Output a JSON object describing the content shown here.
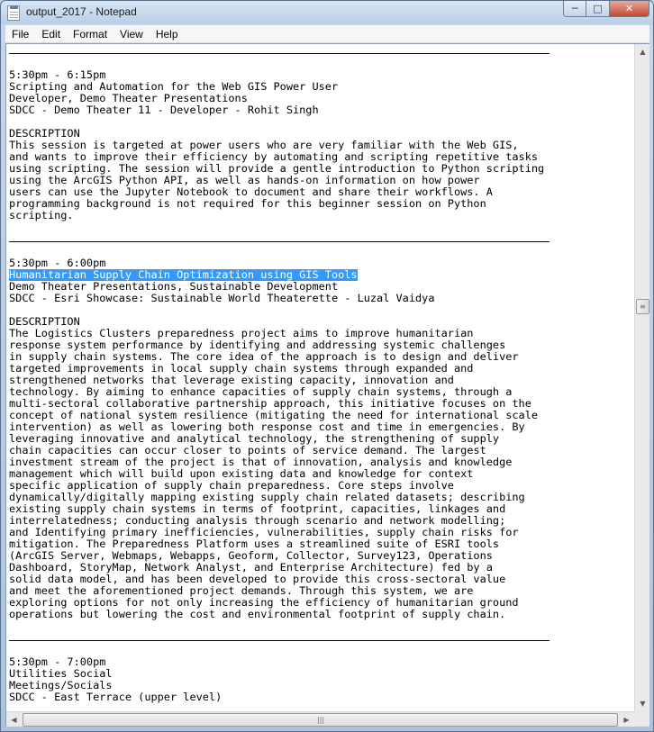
{
  "window": {
    "title": "output_2017 - Notepad",
    "icon": "notepad-icon",
    "buttons": {
      "minimize": "─",
      "maximize": "□",
      "close": "✕"
    }
  },
  "menu": {
    "file": "File",
    "edit": "Edit",
    "format": "Format",
    "view": "View",
    "help": "Help"
  },
  "document": {
    "session1": {
      "time": "5:30pm - 6:15pm",
      "title": "Scripting and Automation for the Web GIS Power User",
      "tracks": "Developer, Demo Theater Presentations",
      "location": "SDCC - Demo Theater 11 - Developer - Rohit Singh",
      "heading": "DESCRIPTION",
      "description": [
        "This session is targeted at power users who are very familiar with the Web GIS,",
        "and wants to improve their efficiency by automating and scripting repetitive tasks",
        "using scripting. The session will provide a gentle introduction to Python scripting",
        "using the ArcGIS Python API, as well as hands-on information on how power",
        "users can use the Jupyter Notebook to document and share their workflows. A",
        "programming background is not required for this beginner session on Python",
        "scripting."
      ]
    },
    "session2": {
      "time": "5:30pm - 6:00pm",
      "title": "Humanitarian Supply Chain Optimization using GIS Tools",
      "tracks": "Demo Theater Presentations, Sustainable Development",
      "location": "SDCC - Esri Showcase: Sustainable World Theaterette - Luzal Vaidya",
      "heading": "DESCRIPTION",
      "description": [
        "The Logistics Clusters preparedness project aims to improve humanitarian",
        "response system performance by identifying and addressing systemic challenges",
        "in supply chain systems. The core idea of the approach is to design and deliver",
        "targeted improvements in local supply chain systems through expanded and",
        "strengthened networks that leverage existing capacity, innovation and",
        "technology. By aiming to enhance capacities of supply chain systems, through a",
        "multi-sectoral collaborative partnership approach, this initiative focuses on the",
        "concept of national system resilience (mitigating the need for international scale",
        "intervention) as well as lowering both response cost and time in emergencies. By",
        "leveraging innovative and analytical technology, the strengthening of supply",
        "chain capacities can occur closer to points of service demand. The largest",
        "investment stream of the project is that of innovation, analysis and knowledge",
        "management which will build upon existing data and knowledge for context",
        "specific application of supply chain preparedness. Core steps involve",
        "dynamically/digitally mapping existing supply chain related datasets; describing",
        "existing supply chain systems in terms of footprint, capacities, linkages and",
        "interrelatedness; conducting analysis through scenario and network modelling;",
        "and Identifying primary inefficiencies, vulnerabilities, supply chain risks for",
        "mitigation. The Preparedness Platform uses a streamlined suite of ESRI tools",
        "(ArcGIS Server, Webmaps, Webapps, Geoform, Collector, Survey123, Operations",
        "Dashboard, StoryMap, Network Analyst, and Enterprise Architecture) fed by a",
        "solid data model, and has been developed to provide this cross-sectoral value",
        "and meet the aforementioned project demands. Through this system, we are",
        "exploring options for not only increasing the efficiency of humanitarian ground",
        "operations but lowering the cost and environmental footprint of supply chain."
      ]
    },
    "session3": {
      "time": "5:30pm - 7:00pm",
      "title": "Utilities Social",
      "tracks": "Meetings/Socials",
      "location": "SDCC - East Terrace (upper level)"
    }
  }
}
